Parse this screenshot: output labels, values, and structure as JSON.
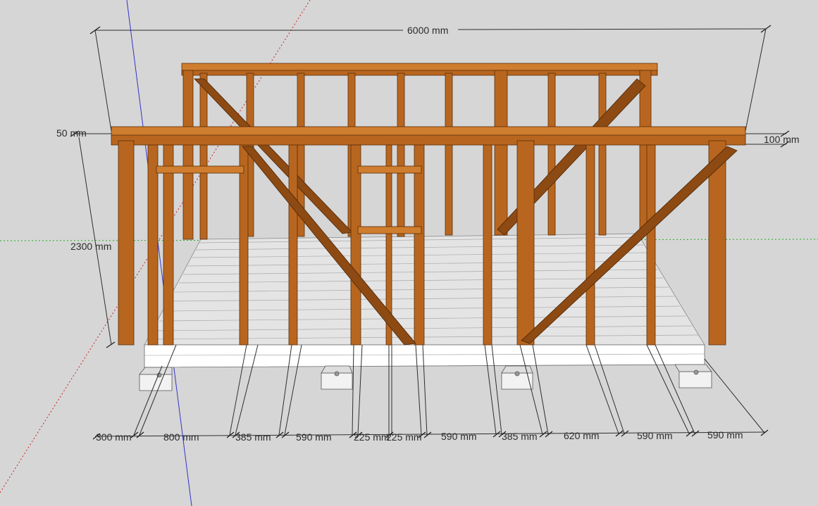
{
  "viewport": {
    "background": "#d6d6d6",
    "axis_colors": {
      "red": "#cc2222",
      "green": "#22aa22",
      "blue": "#3333cc"
    }
  },
  "model": {
    "timber_color": "#b8661f",
    "deck_color": "#e6e6e6",
    "beam_color": "#ffffff"
  },
  "dimensions": {
    "overall_length": "6000 mm",
    "top_thickness_left": "50 mm",
    "top_thickness_right": "100 mm",
    "wall_height": "2300 mm",
    "spacings": [
      "300 mm",
      "800 mm",
      "385 mm",
      "590 mm",
      "225 mm",
      "225 mm",
      "590 mm",
      "385 mm",
      "620 mm",
      "590 mm",
      "590 mm"
    ]
  }
}
